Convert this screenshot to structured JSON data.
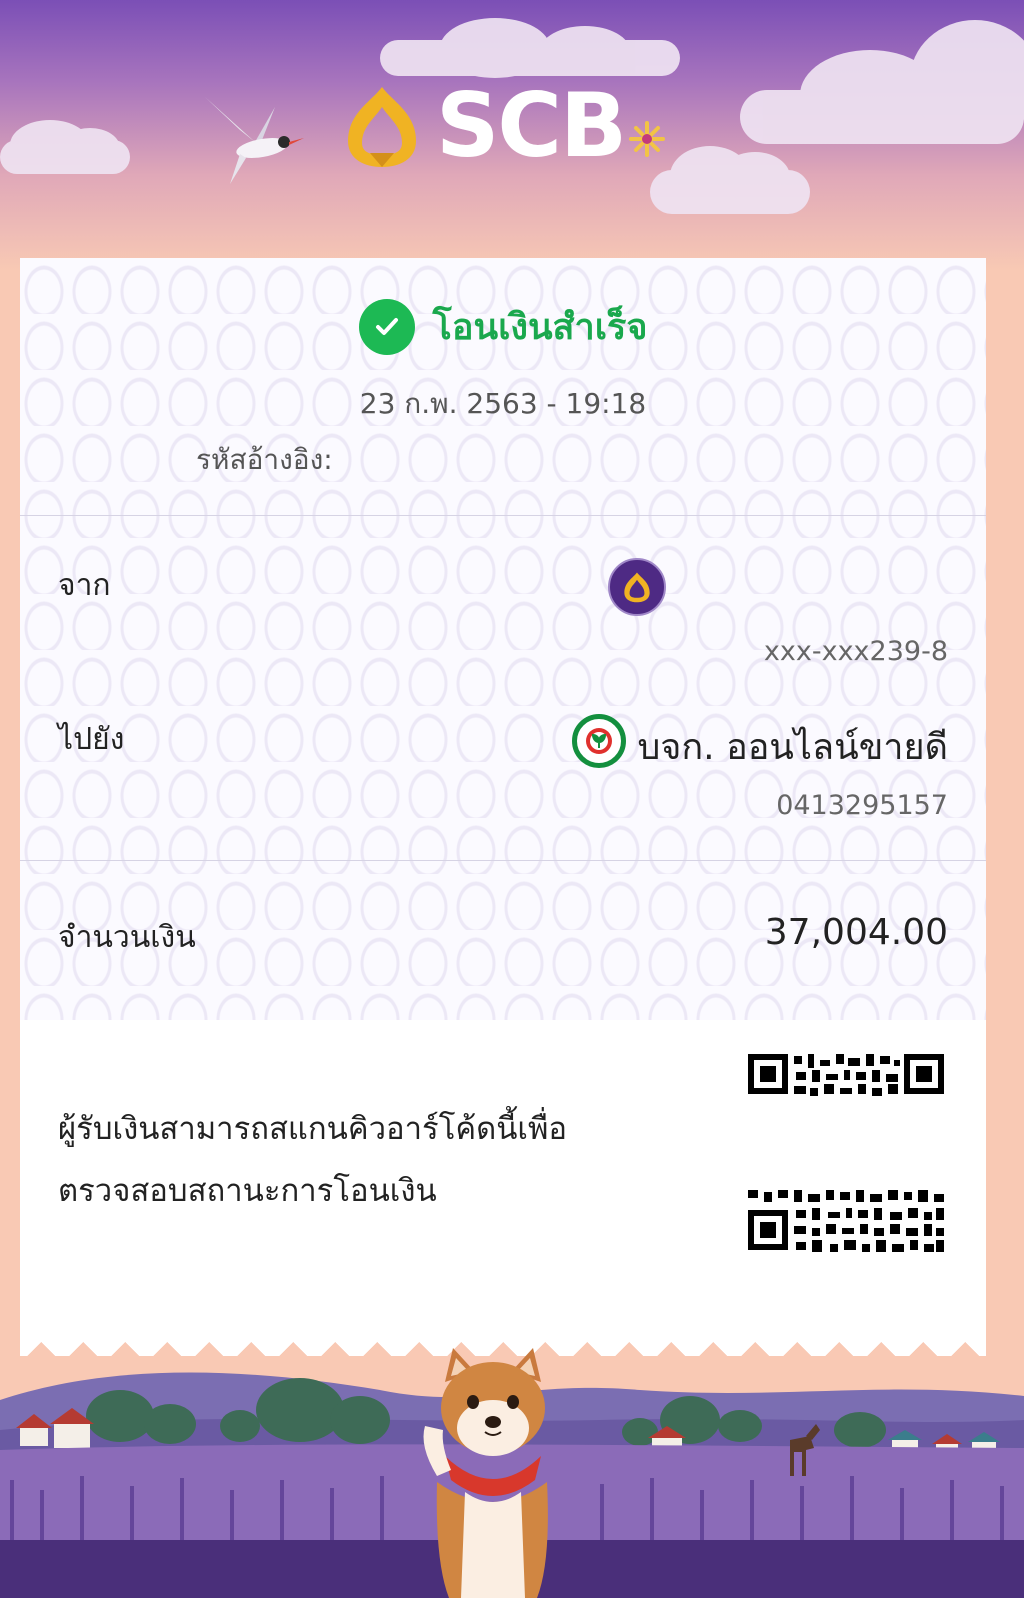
{
  "header": {
    "brand": "SCB"
  },
  "receipt": {
    "status": "โอนเงินสำเร็จ",
    "datetime": "23 ก.พ. 2563 - 19:18",
    "reference_label": "รหัสอ้างอิง:",
    "from_label": "จาก",
    "from_account": "xxx-xxx239-8",
    "to_label": "ไปยัง",
    "to_name": "บจก. ออนไลน์ขายดี",
    "to_account": "0413295157",
    "amount_label": "จำนวนเงิน",
    "amount": "37,004.00",
    "qr_note_line1": "ผู้รับเงินสามารถสแกนคิวอาร์โค้ดนี้เพื่อ",
    "qr_note_line2": "ตรวจสอบสถานะการโอนเงิน"
  },
  "icons": {
    "status": "check-circle-icon",
    "from_bank": "scb-bank-icon",
    "to_bank": "kbank-icon"
  },
  "colors": {
    "success": "#1db954",
    "brand_purple": "#4e2a84",
    "brand_gold": "#f0b323",
    "kbank_green": "#138f3e"
  }
}
